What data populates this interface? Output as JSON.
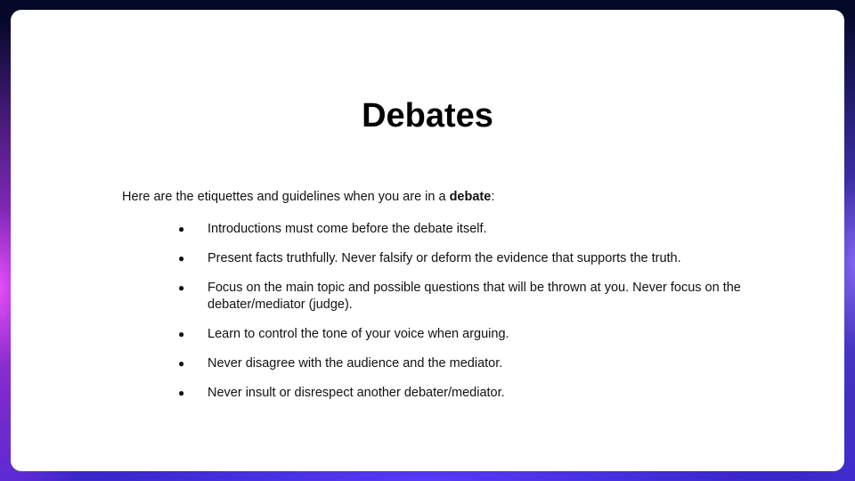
{
  "slide": {
    "title": "Debates",
    "intro_prefix": "Here are the etiquettes and guidelines when you are in a ",
    "intro_bold": "debate",
    "intro_suffix": ":",
    "bullet_glyph": "●",
    "items": [
      "Introductions must come before the debate itself.",
      "Present facts truthfully.  Never falsify or deform the evidence that supports the truth.",
      "Focus on the main topic and possible questions that will be thrown at you. Never focus on the debater/mediator (judge).",
      "Learn to control the tone of your voice when arguing.",
      "Never disagree with the audience and the mediator.",
      "Never insult or disrespect another debater/mediator."
    ]
  }
}
